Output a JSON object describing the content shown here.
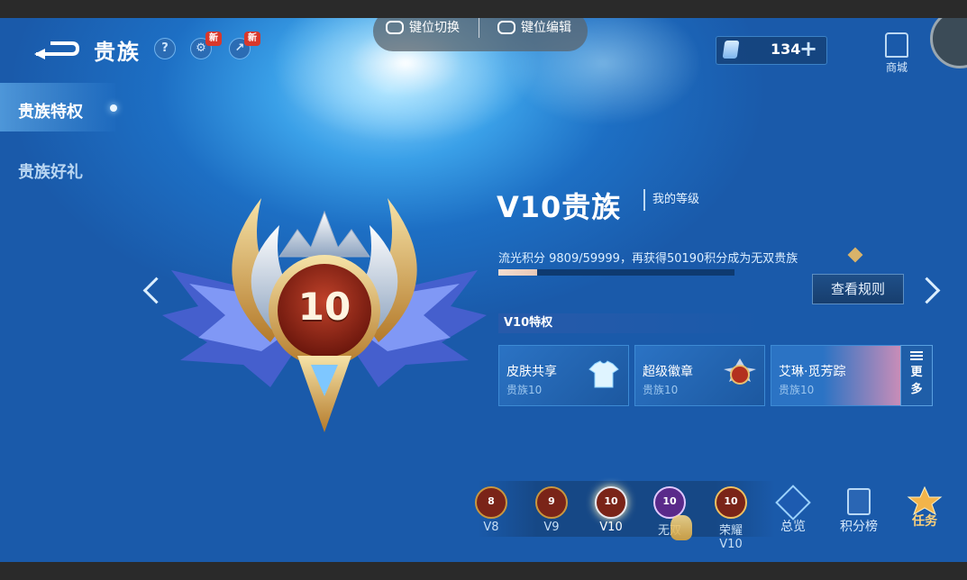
{
  "header": {
    "title": "贵族",
    "help_glyph": "?",
    "new_badge": "新",
    "controls": {
      "switch_label": "键位切换",
      "edit_label": "键位编辑"
    },
    "currency": {
      "value": "134",
      "plus": "+"
    },
    "shop_label": "商城"
  },
  "sidebar": {
    "items": [
      {
        "label": "贵族特权",
        "active": true
      },
      {
        "label": "贵族好礼",
        "active": false
      }
    ]
  },
  "level": {
    "emblem_number": "10",
    "title": "V10贵族",
    "subtitle": "我的等级",
    "points_text": "流光积分 9809/59999，再获得50190积分成为无双贵族",
    "progress": 0.1635,
    "rules_label": "查看规则"
  },
  "privileges": {
    "header": "V10特权",
    "cards": [
      {
        "title": "皮肤共享",
        "sub": "贵族10",
        "icon": "shirt-icon"
      },
      {
        "title": "超级徽章",
        "sub": "贵族10",
        "icon": "badge-icon"
      },
      {
        "title": "艾琳·觅芳踪",
        "sub": "贵族10",
        "icon": "hero-portrait"
      }
    ],
    "more_label_1": "更",
    "more_label_2": "多"
  },
  "levels_nav": [
    {
      "num": "8",
      "label": "V8"
    },
    {
      "num": "9",
      "label": "V9"
    },
    {
      "num": "10",
      "label": "V10"
    },
    {
      "num": "10",
      "label": "无双"
    },
    {
      "num": "10",
      "label": "荣耀V10"
    }
  ],
  "bottom_nav": {
    "overview": "总览",
    "ranking": "积分榜",
    "tasks": "任务"
  },
  "colors": {
    "accent_gold": "#d9b36a",
    "panel_blue": "#1f5ea8",
    "badge_red": "#d8382c"
  }
}
